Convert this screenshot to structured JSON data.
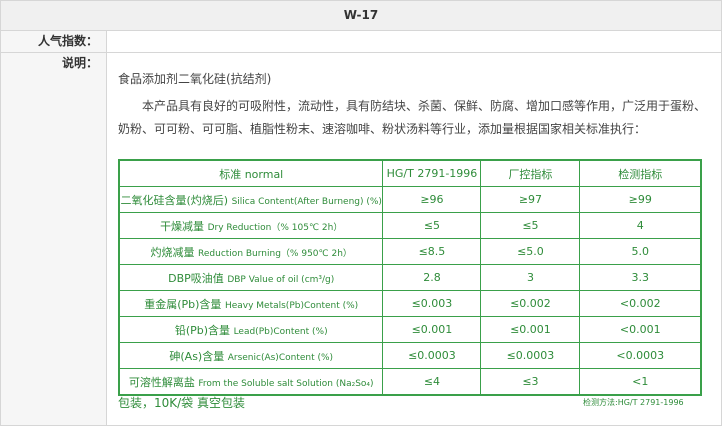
{
  "header": {
    "title": "W-17"
  },
  "popularity": {
    "label": "人气指数：",
    "value": ""
  },
  "description": {
    "label": "说明：",
    "title": "食品添加剂二氧化硅(抗结剂)",
    "paragraph": "本产品具有良好的可吸附性，流动性，具有防结块、杀菌、保鲜、防腐、增加口感等作用，广泛用于蛋粉、奶粉、可可粉、可可脂、植脂性粉末、速溶咖啡、粉状汤料等行业，添加量根据国家相关标准执行："
  },
  "table": {
    "columns": [
      "标准 normal",
      "HG/T 2791-1996",
      "厂控指标",
      "检测指标"
    ],
    "rows": [
      {
        "name_cn": "二氧化硅含量(灼烧后)",
        "name_en": "Silica Content(After Burneng) (%)",
        "standard": "≥96",
        "factory": "≥97",
        "test": "≥99"
      },
      {
        "name_cn": "干燥减量",
        "name_en": "Dry Reduction（% 105℃ 2h）",
        "standard": "≤5",
        "factory": "≤5",
        "test": "4"
      },
      {
        "name_cn": "灼烧减量",
        "name_en": "Reduction Burning（% 950℃ 2h）",
        "standard": "≤8.5",
        "factory": "≤5.0",
        "test": "5.0"
      },
      {
        "name_cn": "DBP吸油值",
        "name_en": "DBP Value of oil (cm³/g)",
        "standard": "2.8",
        "factory": "3",
        "test": "3.3"
      },
      {
        "name_cn": "重金属(Pb)含量",
        "name_en": "Heavy Metals(Pb)Content (%)",
        "standard": "≤0.003",
        "factory": "≤0.002",
        "test": "<0.002"
      },
      {
        "name_cn": "铅(Pb)含量",
        "name_en": "Lead(Pb)Content (%)",
        "standard": "≤0.001",
        "factory": "≤0.001",
        "test": "<0.001"
      },
      {
        "name_cn": "砷(As)含量",
        "name_en": "Arsenic(As)Content (%)",
        "standard": "≤0.0003",
        "factory": "≤0.0003",
        "test": "<0.0003"
      },
      {
        "name_cn": "可溶性解离盐",
        "name_en": "From the Soluble salt Solution (Na₂So₄)",
        "standard": "≤4",
        "factory": "≤3",
        "test": "<1"
      }
    ]
  },
  "footer": {
    "packaging": "包装，10K/袋 真空包装",
    "method": "检测方法:HG/T 2791-1996"
  }
}
